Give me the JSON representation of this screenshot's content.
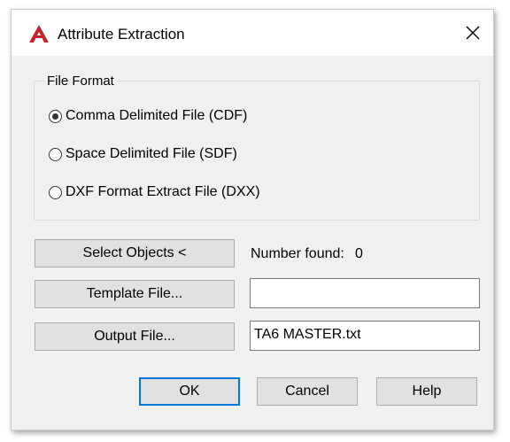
{
  "window": {
    "title": "Attribute Extraction",
    "close_label": "✕"
  },
  "file_format": {
    "legend": "File Format",
    "options": [
      {
        "label": "Comma Delimited File (CDF)",
        "checked": true
      },
      {
        "label": "Space Delimited File (SDF)",
        "checked": false
      },
      {
        "label": "DXF Format Extract File (DXX)",
        "checked": false
      }
    ]
  },
  "select_objects": {
    "label": "Select Objects <",
    "found_label": "Number found:",
    "found_value": "0"
  },
  "template_file": {
    "label": "Template File...",
    "value": ""
  },
  "output_file": {
    "label": "Output File...",
    "value": "TA6 MASTER.txt"
  },
  "buttons": {
    "ok": "OK",
    "cancel": "Cancel",
    "help": "Help"
  },
  "colors": {
    "accent": "#0078d7",
    "brand_red": "#c1272d"
  }
}
